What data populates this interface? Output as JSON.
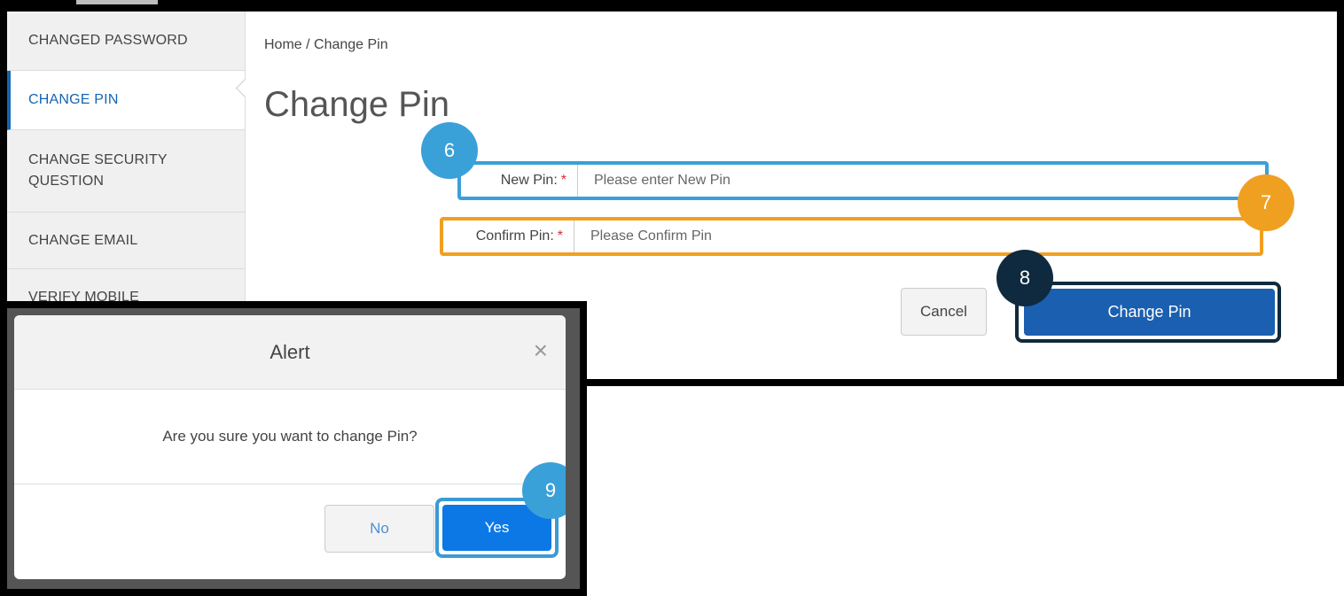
{
  "sidebar": {
    "items": [
      {
        "label": "CHANGED PASSWORD"
      },
      {
        "label": "CHANGE PIN"
      },
      {
        "label": "CHANGE SECURITY QUESTION"
      },
      {
        "label": "CHANGE EMAIL"
      },
      {
        "label": "VERIFY MOBILE"
      }
    ],
    "active_index": 1
  },
  "breadcrumb": "Home / Change Pin",
  "page_title": "Change Pin",
  "form": {
    "new_pin_label": "New Pin:",
    "new_pin_placeholder": "Please enter New Pin",
    "confirm_pin_label": "Confirm Pin:",
    "confirm_pin_placeholder": "Please Confirm Pin",
    "required_mark": "*",
    "cancel_label": "Cancel",
    "submit_label": "Change Pin"
  },
  "step_markers": [
    {
      "number": "6",
      "color": "#3aa0d8"
    },
    {
      "number": "7",
      "color": "#f0a020"
    },
    {
      "number": "8",
      "color": "#0f2a3e"
    },
    {
      "number": "9",
      "color": "#3aa0d8"
    }
  ],
  "dialog": {
    "title": "Alert",
    "close_glyph": "×",
    "message": "Are you sure you want to change Pin?",
    "no_label": "No",
    "yes_label": "Yes"
  },
  "colors": {
    "primary_button": "#1a5fb0",
    "yes_button": "#0b78e6",
    "active_nav": "#1565b0",
    "highlight_blue": "#3aa0d8",
    "highlight_orange": "#f0a020",
    "highlight_navy": "#0f2a3e"
  }
}
